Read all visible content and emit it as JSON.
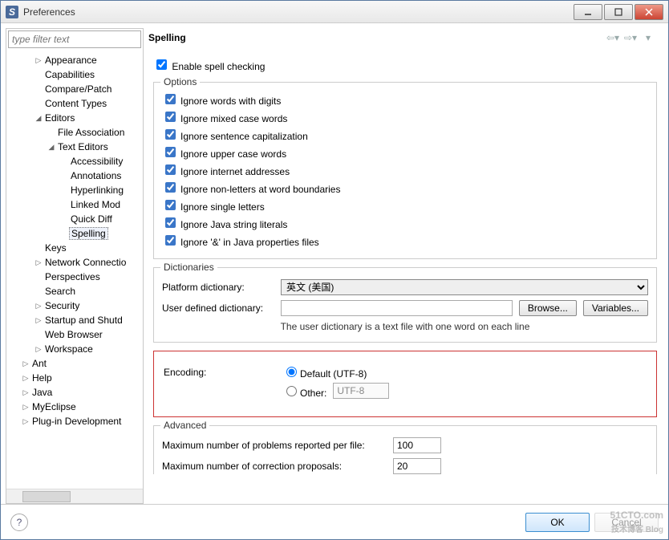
{
  "window": {
    "title": "Preferences"
  },
  "filter": {
    "placeholder": "type filter text"
  },
  "tree": {
    "appearance": "Appearance",
    "capabilities": "Capabilities",
    "compare": "Compare/Patch",
    "content_types": "Content Types",
    "editors": "Editors",
    "file_assoc": "File Association",
    "text_editors": "Text Editors",
    "accessibility": "Accessibility",
    "annotations": "Annotations",
    "hyperlinking": "Hyperlinking",
    "linked_mode": "Linked Mod",
    "quick_diff": "Quick Diff",
    "spelling": "Spelling",
    "keys": "Keys",
    "network": "Network Connectio",
    "perspectives": "Perspectives",
    "search": "Search",
    "security": "Security",
    "startup": "Startup and Shutd",
    "web_browser": "Web Browser",
    "workspace": "Workspace",
    "ant": "Ant",
    "help": "Help",
    "java": "Java",
    "myeclipse": "MyEclipse",
    "plugin_dev": "Plug-in Development"
  },
  "header": {
    "title": "Spelling"
  },
  "enable": {
    "label": "Enable spell checking"
  },
  "options": {
    "legend": "Options",
    "items": [
      "Ignore words with digits",
      "Ignore mixed case words",
      "Ignore sentence capitalization",
      "Ignore upper case words",
      "Ignore internet addresses",
      "Ignore non-letters at word boundaries",
      "Ignore single letters",
      "Ignore Java string literals",
      "Ignore '&' in Java properties files"
    ]
  },
  "dict": {
    "legend": "Dictionaries",
    "platform_label": "Platform dictionary:",
    "platform_value": "英文 (美国)",
    "user_label": "User defined dictionary:",
    "user_value": "",
    "browse": "Browse...",
    "variables": "Variables...",
    "hint": "The user dictionary is a text file with one word on each line"
  },
  "encoding": {
    "label": "Encoding:",
    "default_label": "Default (UTF-8)",
    "other_label": "Other:",
    "other_value": "UTF-8"
  },
  "advanced": {
    "legend": "Advanced",
    "max_problems_label": "Maximum number of problems reported per file:",
    "max_problems_value": "100",
    "max_proposals_label": "Maximum number of correction proposals:",
    "max_proposals_value": "20"
  },
  "footer": {
    "ok": "OK",
    "cancel": "Cancel"
  },
  "watermark": {
    "main": "51CTO.com",
    "sub": "技术博客  Blog"
  }
}
